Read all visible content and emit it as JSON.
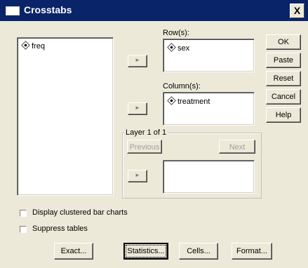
{
  "window": {
    "title": "Crosstabs",
    "close_label": "X"
  },
  "source_list": {
    "items": [
      {
        "label": "freq",
        "icon": "scale-variable-icon"
      }
    ]
  },
  "rows": {
    "label": "Row(s):",
    "items": [
      {
        "label": "sex",
        "icon": "scale-variable-icon"
      }
    ],
    "arrow": "►"
  },
  "columns": {
    "label": "Column(s):",
    "items": [
      {
        "label": "treatment",
        "icon": "scale-variable-icon"
      }
    ],
    "arrow": "►"
  },
  "layer": {
    "label": "Layer 1 of 1",
    "previous_label": "Previous",
    "next_label": "Next",
    "arrow": "►"
  },
  "side_buttons": {
    "ok": "OK",
    "paste": "Paste",
    "reset": "Reset",
    "cancel": "Cancel",
    "help": "Help"
  },
  "options": {
    "clustered_bar": "Display clustered bar charts",
    "suppress_tables": "Suppress tables"
  },
  "bottom_buttons": {
    "exact": "Exact...",
    "statistics": "Statistics...",
    "cells": "Cells...",
    "format": "Format..."
  }
}
